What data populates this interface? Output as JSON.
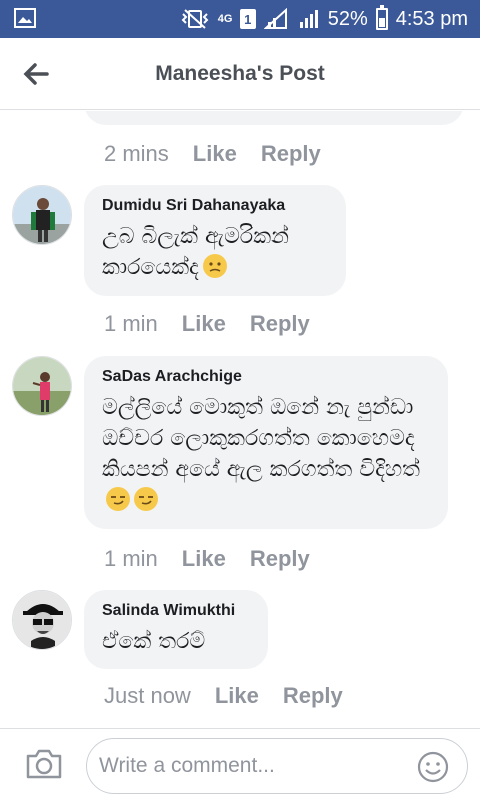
{
  "status_bar": {
    "network": "4G",
    "sim": "1",
    "battery": "52%",
    "battery_level": 0.52,
    "time": "4:53 pm",
    "icons": [
      "image-icon",
      "mute-vibrate-icon",
      "signal-icon",
      "battery-icon"
    ]
  },
  "header": {
    "back_icon": "back-arrow-icon",
    "title": "Maneesha's Post"
  },
  "previous_comment_meta": {
    "time": "2 mins",
    "like": "Like",
    "reply": "Reply"
  },
  "comments": [
    {
      "author": "Dumidu Sri Dahanayaka",
      "text": "උබ බිලැක් ඇමරිකන් කාරයෙක්ද",
      "emojis": [
        "confused-face-emoji"
      ],
      "time": "1 min",
      "like": "Like",
      "reply": "Reply"
    },
    {
      "author": "SaDas Arachchige",
      "text": "මල්ලියේ මොකුත් ඔනේ නැ පුන්ඩා ඔච්චර ලොකුකරගත්ත කොහෙමද කියපන් අයේ ඇල කරගත්ත විදිහත්",
      "emojis": [
        "smirk-face-emoji",
        "smirk-face-emoji"
      ],
      "time": "1 min",
      "like": "Like",
      "reply": "Reply"
    },
    {
      "author": "Salinda Wimukthi",
      "text": "ඒකේ තරම්",
      "emojis": [],
      "time": "Just now",
      "like": "Like",
      "reply": "Reply"
    }
  ],
  "composer": {
    "camera_icon": "camera-icon",
    "placeholder": "Write a comment...",
    "emoji_icon": "smiley-icon"
  },
  "colors": {
    "status_bar_bg": "#3b5998",
    "bubble_bg": "#f2f3f5",
    "meta_text": "#90949c"
  }
}
